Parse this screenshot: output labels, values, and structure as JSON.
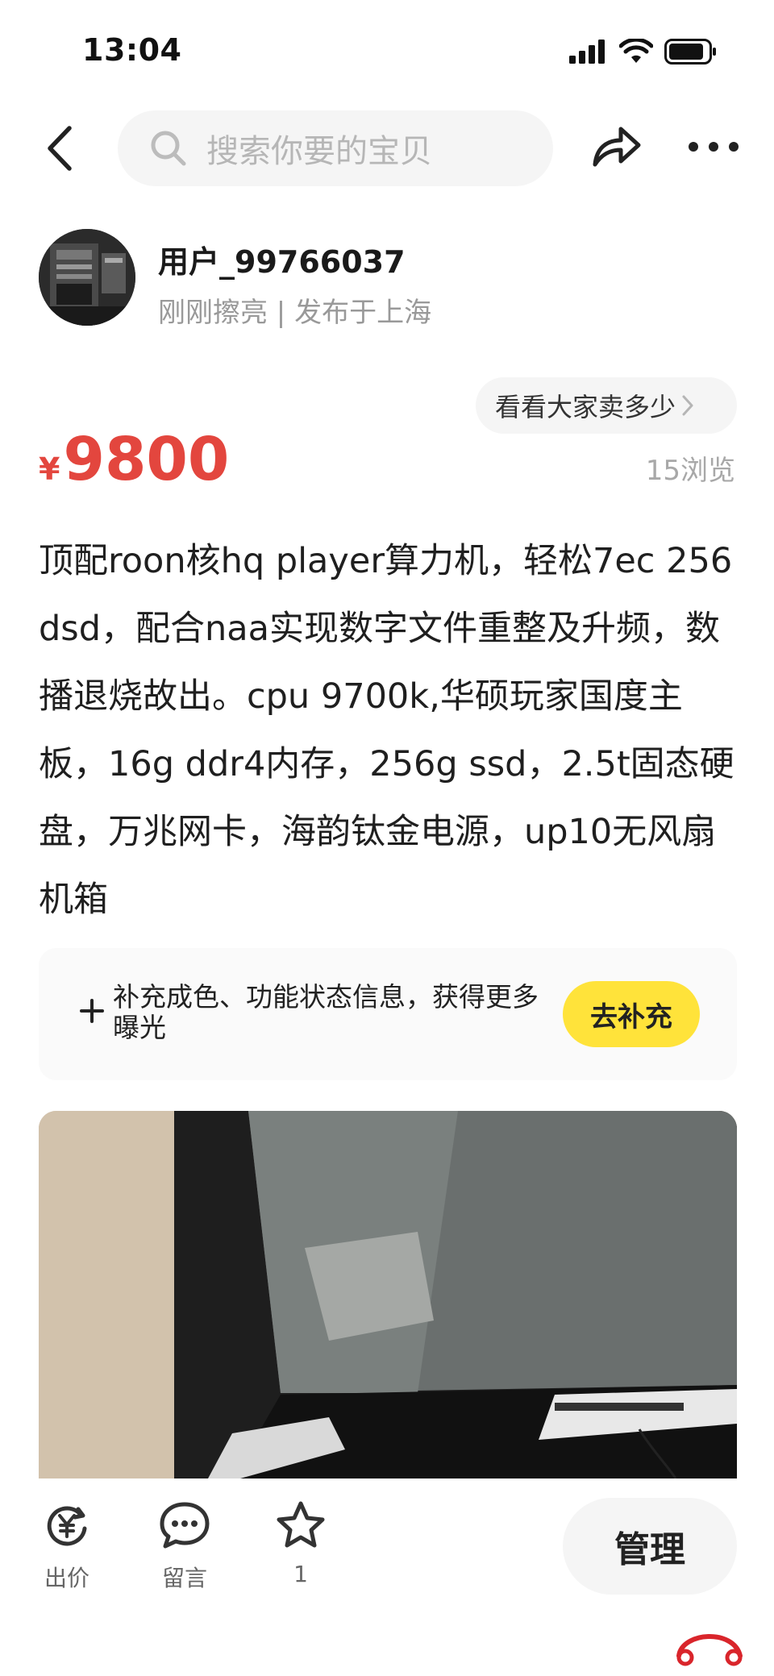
{
  "status_bar": {
    "time": "13:04"
  },
  "nav": {
    "back_icon": "chevron-left-icon",
    "search_placeholder": "搜索你要的宝贝",
    "share_icon": "share-icon",
    "more_icon": "more-icon"
  },
  "seller": {
    "name": "用户_99766037",
    "meta": "刚刚擦亮 | 发布于上海"
  },
  "price_check": {
    "label": "看看大家卖多少"
  },
  "listing": {
    "currency": "¥",
    "price": "9800",
    "views": "15浏览",
    "description": "顶配roon核hq player算力机，轻松7ec 256dsd，配合naa实现数字文件重整及升频，数播退烧故出。cpu 9700k,华硕玩家国度主板，16g ddr4内存，256g ssd，2.5t固态硬盘，万兆网卡，海韵钛金电源，up10无风扇机箱"
  },
  "supplement": {
    "text": "补充成色、功能状态信息，获得更多曝光",
    "button": "去补充"
  },
  "bottom_bar": {
    "bid_label": "出价",
    "comment_label": "留言",
    "favorite_count": "1",
    "manage_label": "管理"
  },
  "colors": {
    "price_red": "#e3463e",
    "accent_yellow": "#ffe33a",
    "muted_gray": "#999999"
  }
}
